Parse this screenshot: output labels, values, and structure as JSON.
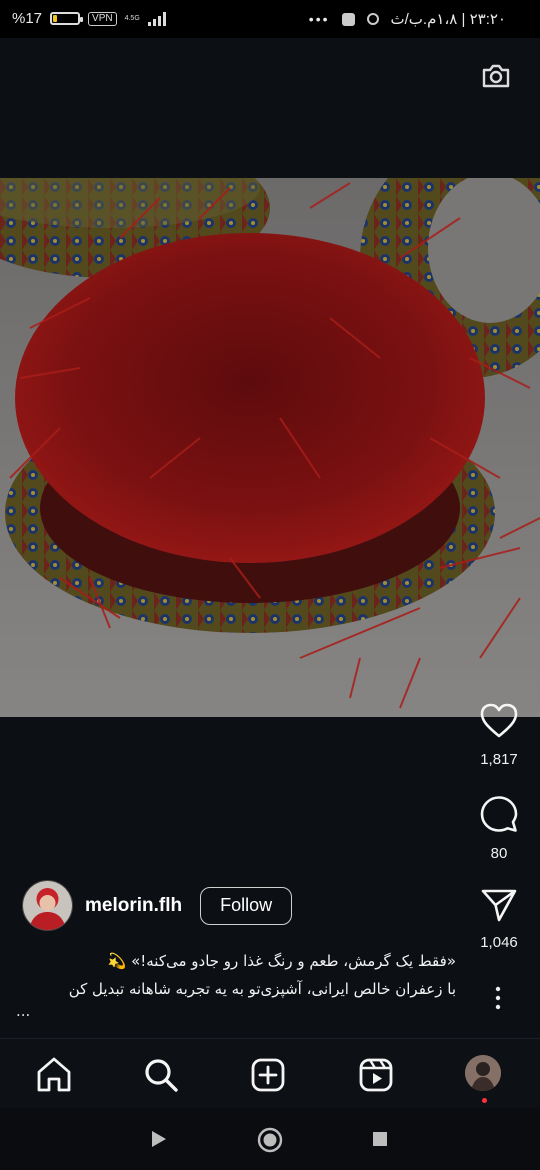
{
  "status_bar": {
    "battery_text": "%17",
    "battery_level": 0.17,
    "vpn_label": "VPN",
    "network_type": "4.5G",
    "time_text": "۲۳:۲۰ | ۱،۸م.ب/ث",
    "overflow_dots": "•••"
  },
  "post": {
    "image_icon": "saffron-photo",
    "likes": "1,817",
    "comments": "80",
    "shares": "1,046",
    "author": {
      "username": "melorin.flh",
      "follow_label": "Follow"
    },
    "caption_line1": "«فقط یک گرمش، طعم و رنگ غذا رو جادو می‌کنه!» 💫",
    "caption_line2": "با زعفران خالص ایرانی، آشپزی‌تو به یه تجربه شاهانه تبدیل کن",
    "caption_more": "..."
  },
  "bottom_nav": {
    "items": [
      "home-icon",
      "search-icon",
      "create-icon",
      "reels-icon",
      "profile-avatar"
    ]
  },
  "colors": {
    "background": "#0c0f14",
    "accent_red": "#ff3040",
    "battery_yellow": "#f0c419"
  }
}
